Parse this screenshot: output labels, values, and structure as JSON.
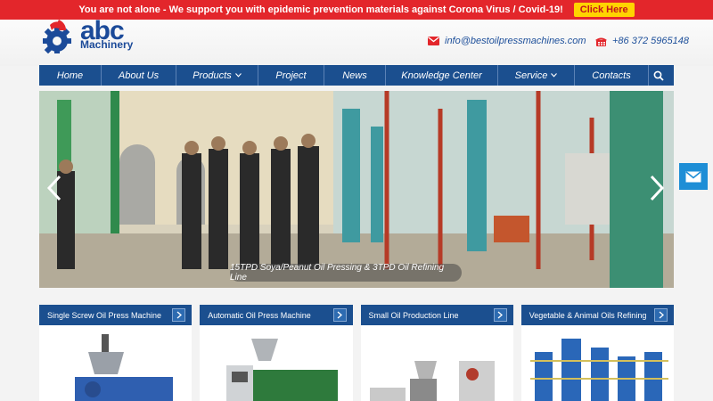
{
  "alert": {
    "text": "You are not alone - We support you with epidemic prevention materials against Corona Virus / Covid-19!",
    "button": "Click Here"
  },
  "logo": {
    "brand": "abc",
    "tagline": "Machinery"
  },
  "contact": {
    "email": "info@bestoilpressmachines.com",
    "phone": "+86 372 5965148"
  },
  "nav": {
    "items": [
      {
        "label": "Home",
        "dropdown": false
      },
      {
        "label": "About Us",
        "dropdown": false
      },
      {
        "label": "Products",
        "dropdown": true
      },
      {
        "label": "Project",
        "dropdown": false
      },
      {
        "label": "News",
        "dropdown": false
      },
      {
        "label": "Knowledge Center",
        "dropdown": false
      },
      {
        "label": "Service",
        "dropdown": true
      },
      {
        "label": "Contacts",
        "dropdown": false
      }
    ]
  },
  "hero": {
    "caption": "15TPD Soya/Peanut Oil Pressing & 3TPD Oil Refining Line"
  },
  "cards": [
    {
      "title": "Single Screw Oil Press Machine"
    },
    {
      "title": "Automatic Oil Press Machine"
    },
    {
      "title": "Small Oil Production Line"
    },
    {
      "title": "Vegetable & Animal Oils Refining"
    }
  ],
  "colors": {
    "alert": "#e3262b",
    "button": "#ffd400",
    "nav": "#1b4f8f",
    "accent": "#1e8ed6"
  }
}
